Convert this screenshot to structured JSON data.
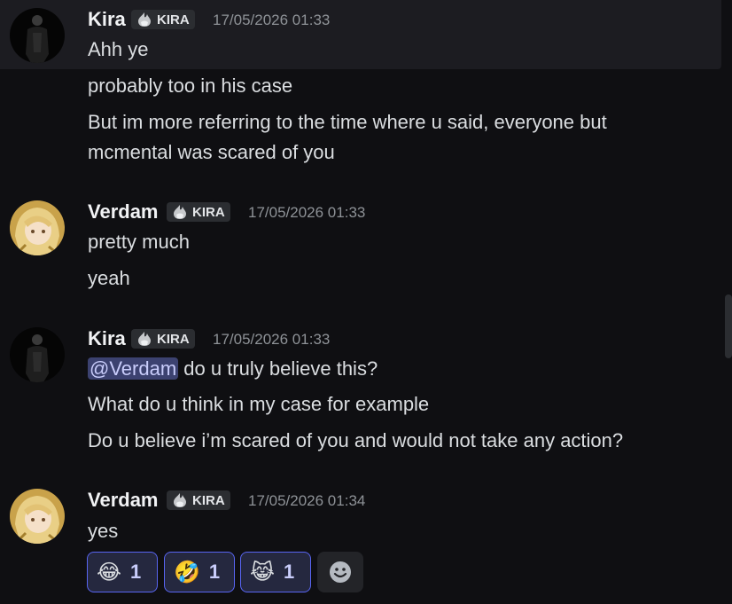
{
  "messages": [
    {
      "author": "Kira",
      "role_tag": "KIRA",
      "timestamp": "17/05/2026 01:33",
      "lines": [
        "Ahh ye",
        "probably too in his case",
        "But im more referring to the time where u said, everyone but",
        "mcmental was scared of you"
      ]
    },
    {
      "author": "Verdam",
      "role_tag": "KIRA",
      "timestamp": "17/05/2026 01:33",
      "lines": [
        "pretty much",
        "yeah"
      ]
    },
    {
      "author": "Kira",
      "role_tag": "KIRA",
      "timestamp": "17/05/2026 01:33",
      "mention": "@Verdam",
      "lines": [
        " do u truly believe this?",
        "What do u think in my case for example",
        "Do u believe i’m scared of you and would not take any action?"
      ]
    },
    {
      "author": "Verdam",
      "role_tag": "KIRA",
      "timestamp": "17/05/2026 01:34",
      "lines": [
        "yes"
      ],
      "reactions": [
        {
          "emoji": "😂",
          "count": "1"
        },
        {
          "emoji": "🤣",
          "count": "1"
        },
        {
          "emoji": "😹",
          "count": "1"
        }
      ]
    }
  ],
  "icons": {
    "role_icon": "flame-badge-icon",
    "add_reaction": "smiley-add-reaction-icon"
  },
  "colors": {
    "background": "#0f0f12",
    "hover": "#1c1c21",
    "mention_bg": "#3c4270",
    "reaction_border": "#5865f2"
  }
}
